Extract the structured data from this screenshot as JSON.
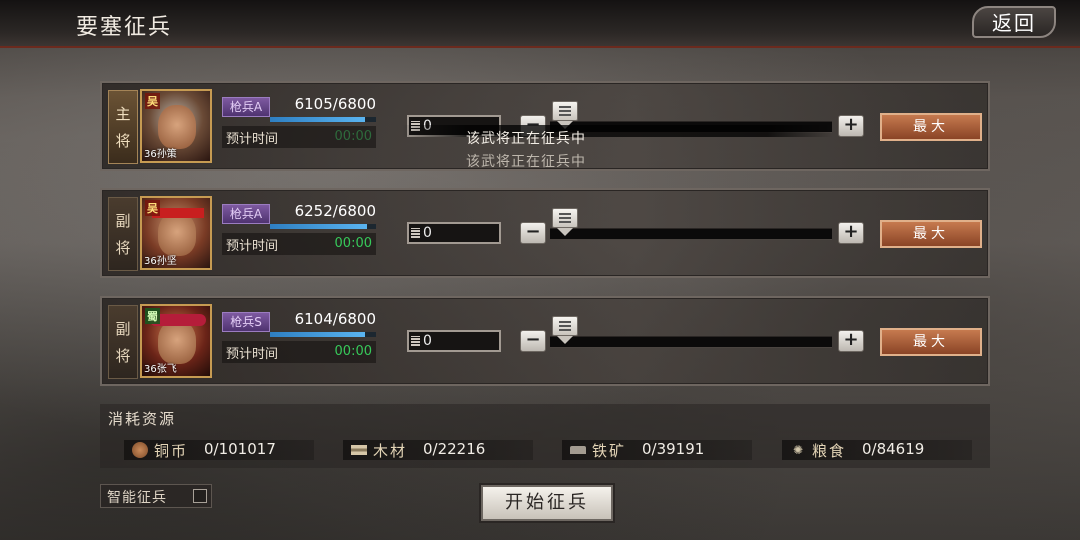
{
  "header": {
    "title": "要塞征兵",
    "back_label": "返回"
  },
  "generals": [
    {
      "role_chars": [
        "主",
        "将"
      ],
      "faction": "吴",
      "level_name": "36孙策",
      "troop_type": "枪兵A",
      "troops": "6105/6800",
      "troop_fraction": 0.898,
      "eta_label": "预计时间",
      "eta_time": "00:00",
      "quantity": "0",
      "max_label": "最大",
      "busy_text": "该武将正在征兵中"
    },
    {
      "role_chars": [
        "副",
        "将"
      ],
      "faction": "吴",
      "level_name": "36孙坚",
      "troop_type": "枪兵A",
      "troops": "6252/6800",
      "troop_fraction": 0.919,
      "eta_label": "预计时间",
      "eta_time": "00:00",
      "quantity": "0",
      "max_label": "最大"
    },
    {
      "role_chars": [
        "副",
        "将"
      ],
      "faction": "蜀",
      "level_name": "36张飞",
      "troop_type": "枪兵S",
      "troops": "6104/6800",
      "troop_fraction": 0.898,
      "eta_label": "预计时间",
      "eta_time": "00:00",
      "quantity": "0",
      "max_label": "最大"
    }
  ],
  "resources": {
    "title": "消耗资源",
    "items": [
      {
        "name": "铜币",
        "value": "0/101017",
        "icon": "coin-icon"
      },
      {
        "name": "木材",
        "value": "0/22216",
        "icon": "wood-icon"
      },
      {
        "name": "铁矿",
        "value": "0/39191",
        "icon": "iron-icon"
      },
      {
        "name": "粮食",
        "value": "0/84619",
        "icon": "grain-icon"
      }
    ]
  },
  "footer": {
    "smart_label": "智能征兵",
    "start_label": "开始征兵"
  },
  "colors": {
    "accent_green": "#37c95a",
    "max_button": "#b06238",
    "troop_bar": "#3d97d8"
  }
}
